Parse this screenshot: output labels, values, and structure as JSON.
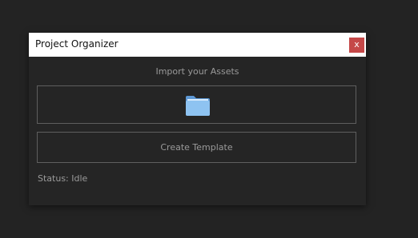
{
  "window": {
    "title": "Project Organizer",
    "close_label": "x"
  },
  "main": {
    "import_heading": "Import your Assets",
    "import_icon": "folder-icon",
    "create_template_label": "Create Template",
    "status_text": "Status: Idle"
  },
  "colors": {
    "background": "#232323",
    "panel": "#252525",
    "titlebar": "#ffffff",
    "close_button": "#c54848",
    "folder_front": "#8ec3f1",
    "folder_back": "#5d98d4"
  }
}
